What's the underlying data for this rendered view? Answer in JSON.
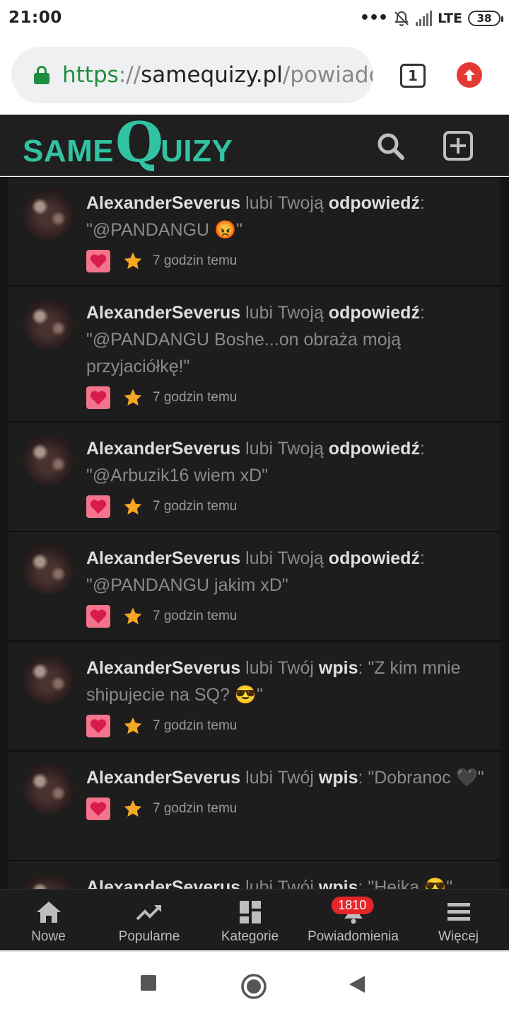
{
  "status_bar": {
    "time": "21:00",
    "network": "LTE",
    "battery": "38"
  },
  "browser": {
    "url_scheme": "https",
    "url_sep": "://",
    "url_host": "samequizy.pl",
    "url_path": "/powiadc",
    "tab_count": "1"
  },
  "site": {
    "logo_same": "SAME",
    "logo_q": "Q",
    "logo_uizy": "UIZY"
  },
  "notifications": [
    {
      "user": "AlexanderSeverus",
      "action": " lubi Twoją ",
      "kind": "odpowiedź",
      "quote": ": \"@PANDANGU 😡\"",
      "time": "7 godzin temu"
    },
    {
      "user": "AlexanderSeverus",
      "action": " lubi Twoją ",
      "kind": "odpowiedź",
      "quote": ": \"@PANDANGU Boshe...on obraża moją przyjaciółkę!\"",
      "time": "7 godzin temu"
    },
    {
      "user": "AlexanderSeverus",
      "action": " lubi Twoją ",
      "kind": "odpowiedź",
      "quote": ": \"@Arbuzik16 wiem xD\"",
      "time": "7 godzin temu"
    },
    {
      "user": "AlexanderSeverus",
      "action": " lubi Twoją ",
      "kind": "odpowiedź",
      "quote": ": \"@PANDANGU jakim xD\"",
      "time": "7 godzin temu"
    },
    {
      "user": "AlexanderSeverus",
      "action": " lubi Twój ",
      "kind": "wpis",
      "quote": ": \"Z kim mnie shipujecie na SQ? 😎\"",
      "time": "7 godzin temu"
    },
    {
      "user": "AlexanderSeverus",
      "action": " lubi Twój ",
      "kind": "wpis",
      "quote": ": \"Dobranoc 🖤\"",
      "time": "7 godzin temu"
    },
    {
      "user": "AlexanderSeverus",
      "action": " lubi Twój ",
      "kind": "wpis",
      "quote": ": \"Hejka 😎\"",
      "time": ""
    }
  ],
  "bottom_nav": {
    "new_label": "Nowe",
    "popular_label": "Popularne",
    "categories_label": "Kategorie",
    "notifications_label": "Powiadomienia",
    "notifications_badge": "1810",
    "more_label": "Więcej"
  },
  "colors": {
    "brand": "#31c2a2",
    "heart_badge": "#f4748b",
    "heart": "#d81b4a",
    "star": "#f5a623",
    "badge": "#e52528"
  }
}
